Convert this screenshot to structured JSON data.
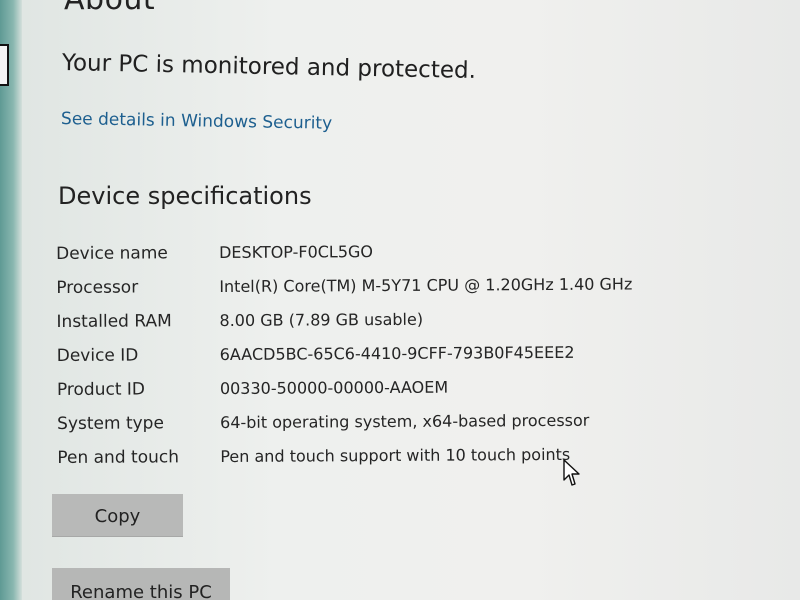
{
  "page": {
    "heading": "About",
    "protection_message": "Your PC is monitored and protected.",
    "security_link": "See details in Windows Security"
  },
  "device_specs": {
    "title": "Device specifications",
    "rows": [
      {
        "label": "Device name",
        "value": "DESKTOP-F0CL5GO"
      },
      {
        "label": "Processor",
        "value": "Intel(R) Core(TM) M-5Y71 CPU @ 1.20GHz   1.40 GHz"
      },
      {
        "label": "Installed RAM",
        "value": "8.00 GB (7.89 GB usable)"
      },
      {
        "label": "Device ID",
        "value": "6AACD5BC-65C6-4410-9CFF-793B0F45EEE2"
      },
      {
        "label": "Product ID",
        "value": "00330-50000-00000-AAOEM"
      },
      {
        "label": "System type",
        "value": "64-bit operating system, x64-based processor"
      },
      {
        "label": "Pen and touch",
        "value": "Pen and touch support with 10 touch points"
      }
    ]
  },
  "actions": {
    "copy": "Copy",
    "rename": "Rename this PC"
  },
  "icons": {
    "cursor": "mouse-pointer-icon",
    "left_nav": "partial-window-edge"
  },
  "colors": {
    "link": "#1d5f8f",
    "button_bg": "#b8b9b8",
    "accent_strip": "#5f9a94"
  }
}
